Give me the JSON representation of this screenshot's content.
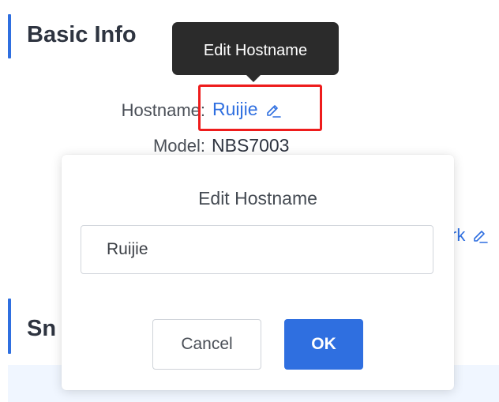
{
  "sections": {
    "basic_info_title": "Basic Info",
    "second_section_title_partial": "Sn"
  },
  "tooltip": {
    "text": "Edit Hostname"
  },
  "info": {
    "hostname_label": "Hostname:",
    "hostname_value": "Ruijie",
    "model_label": "Model:",
    "model_value": "NBS7003",
    "remark_partial": "rk"
  },
  "dialog": {
    "title": "Edit Hostname",
    "input_value": "Ruijie",
    "cancel_label": "Cancel",
    "ok_label": "OK"
  },
  "icons": {
    "edit": "pencil-icon"
  },
  "colors": {
    "accent": "#2f6fe0",
    "highlight": "#ee1c1c",
    "tooltip_bg": "#2b2b2b",
    "band": "#f0f6ff"
  }
}
